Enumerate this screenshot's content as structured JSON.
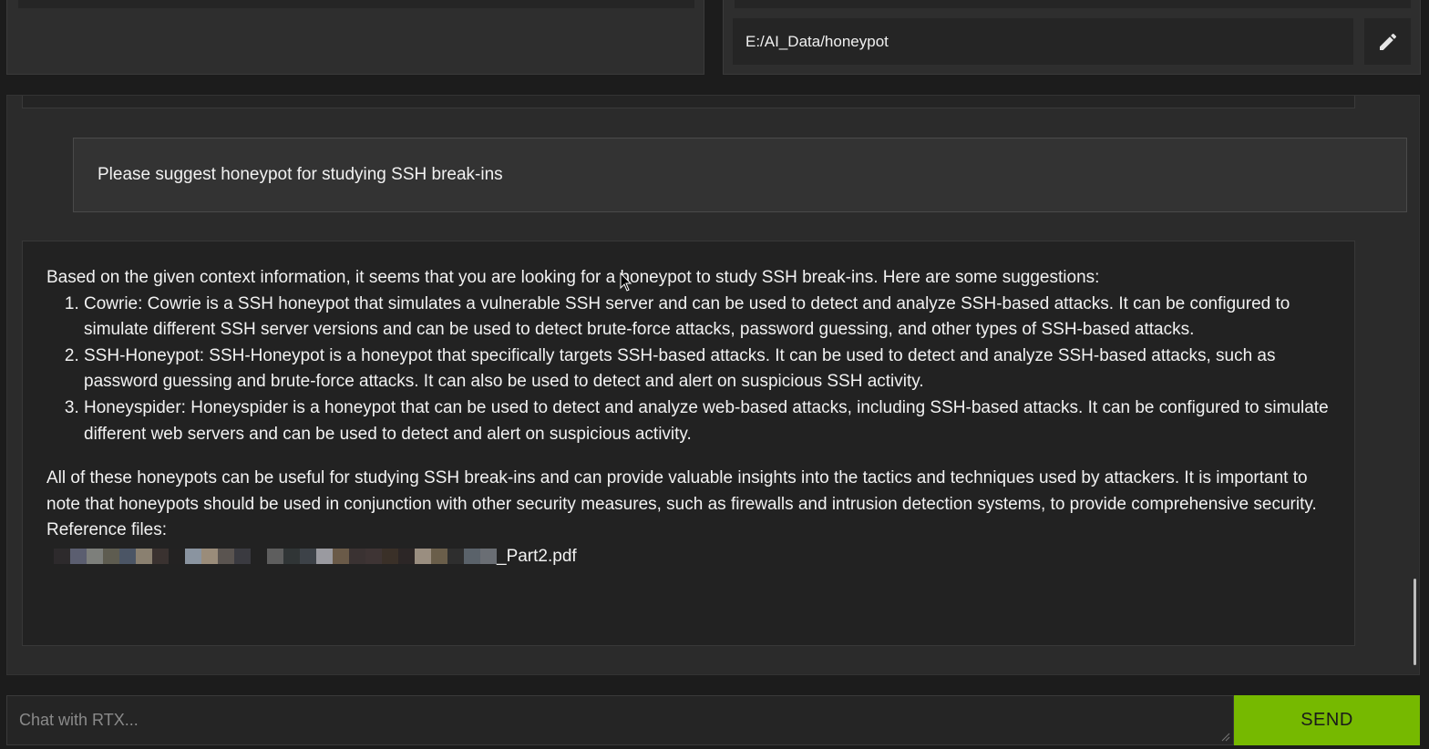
{
  "settings": {
    "folder_path": "E:/AI_Data/honeypot"
  },
  "conversation": {
    "user_message": "Please suggest honeypot for studying SSH break-ins",
    "assistant": {
      "intro": "Based on the given context information, it seems that you are looking for a honeypot to study SSH break-ins. Here are some suggestions:",
      "suggestions": [
        "Cowrie: Cowrie is a SSH honeypot that simulates a vulnerable SSH server and can be used to detect and analyze SSH-based attacks. It can be configured to simulate different SSH server versions and can be used to detect brute-force attacks, password guessing, and other types of SSH-based attacks.",
        "SSH-Honeypot: SSH-Honeypot is a honeypot that specifically targets SSH-based attacks. It can be used to detect and analyze SSH-based attacks, such as password guessing and brute-force attacks. It can also be used to detect and alert on suspicious SSH activity.",
        "Honeyspider: Honeyspider is a honeypot that can be used to detect and analyze web-based attacks, including SSH-based attacks. It can be configured to simulate different web servers and can be used to detect and alert on suspicious activity."
      ],
      "closing": "All of these honeypots can be useful for studying SSH break-ins and can provide valuable insights into the tactics and techniques used by attackers. It is important to note that honeypots should be used in conjunction with other security measures, such as firewalls and intrusion detection systems, to provide comprehensive security.",
      "reference_label": "Reference files:",
      "reference_file_suffix": "_Part2.pdf"
    }
  },
  "input": {
    "placeholder": "Chat with RTX...",
    "send_label": "SEND"
  },
  "colors": {
    "accent": "#76b900",
    "background": "#1c1c1c",
    "panel": "#2b2b2b"
  },
  "icons": {
    "edit": "pencil-icon"
  }
}
